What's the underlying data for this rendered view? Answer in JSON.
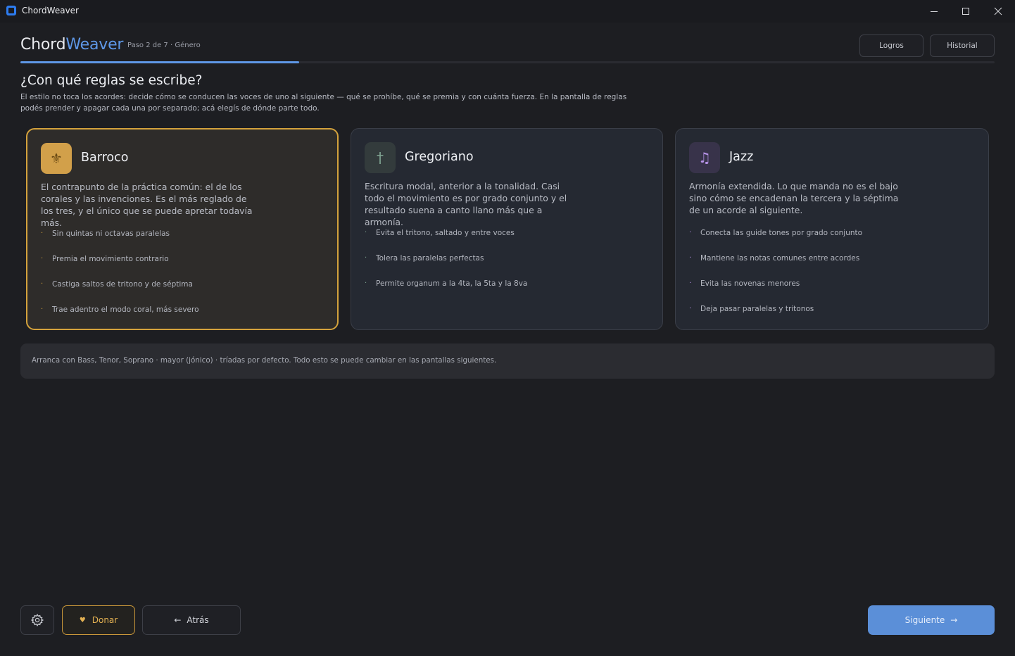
{
  "window": {
    "title": "ChordWeaver",
    "minimize_icon": "minimize-icon",
    "maximize_icon": "maximize-icon",
    "close_icon": "close-icon"
  },
  "header": {
    "brand_part1": "Chord",
    "brand_part2": "Weaver",
    "step_label": "Paso 2 de 7 · Género",
    "achievements_label": "Logros",
    "history_label": "Historial",
    "progress_fraction": 0.286
  },
  "main": {
    "heading": "¿Con qué reglas se escribe?",
    "description": "El estilo no toca los acordes: decide cómo se conducen las voces de uno al siguiente — qué se prohíbe, qué se premia y con cuánta fuerza. En la pantalla de reglas podés prender y apagar cada una por separado; acá elegís de dónde parte todo.",
    "cards": [
      {
        "title": "Barroco",
        "icon": "fleur-de-lis-icon",
        "glyph": "⚜",
        "selected": true,
        "description": "El contrapunto de la práctica común: el de los corales y las invenciones. Es el más reglado de los tres, y el único que se puede apretar todavía más.",
        "bullets": [
          "Sin quintas ni octavas paralelas",
          "Premia el movimiento contrario",
          "Castiga saltos de tritono y de séptima",
          "Trae adentro el modo coral, más severo"
        ]
      },
      {
        "title": "Gregoriano",
        "icon": "cross-icon",
        "glyph": "†",
        "selected": false,
        "description": "Escritura modal, anterior a la tonalidad. Casi todo el movimiento es por grado conjunto y el resultado suena a canto llano más que a armonía.",
        "bullets": [
          "Evita el tritono, saltado y entre voces",
          "Tolera las paralelas perfectas",
          "Permite organum a la 4ta, la 5ta y la 8va"
        ]
      },
      {
        "title": "Jazz",
        "icon": "music-note-icon",
        "glyph": "♫",
        "selected": false,
        "description": "Armonía extendida. Lo que manda no es el bajo sino cómo se encadenan la tercera y la séptima de un acorde al siguiente.",
        "bullets": [
          "Conecta las guide tones por grado conjunto",
          "Mantiene las notas comunes entre acordes",
          "Evita las novenas menores",
          "Deja pasar paralelas y tritonos"
        ]
      }
    ],
    "info_text": "Arranca con Bass, Tenor, Soprano · mayor (jónico) · tríadas por defecto. Todo esto se puede cambiar en las pantallas siguientes."
  },
  "footer": {
    "settings_icon": "gear-icon",
    "donate_label": "Donar",
    "donate_glyph": "♥",
    "back_label": "Atrás",
    "back_glyph": "←",
    "next_label": "Siguiente",
    "next_glyph": "→"
  },
  "colors": {
    "accent_blue": "#5e97e6",
    "selected_gold": "#d4a23c",
    "background": "#1d1e22"
  }
}
